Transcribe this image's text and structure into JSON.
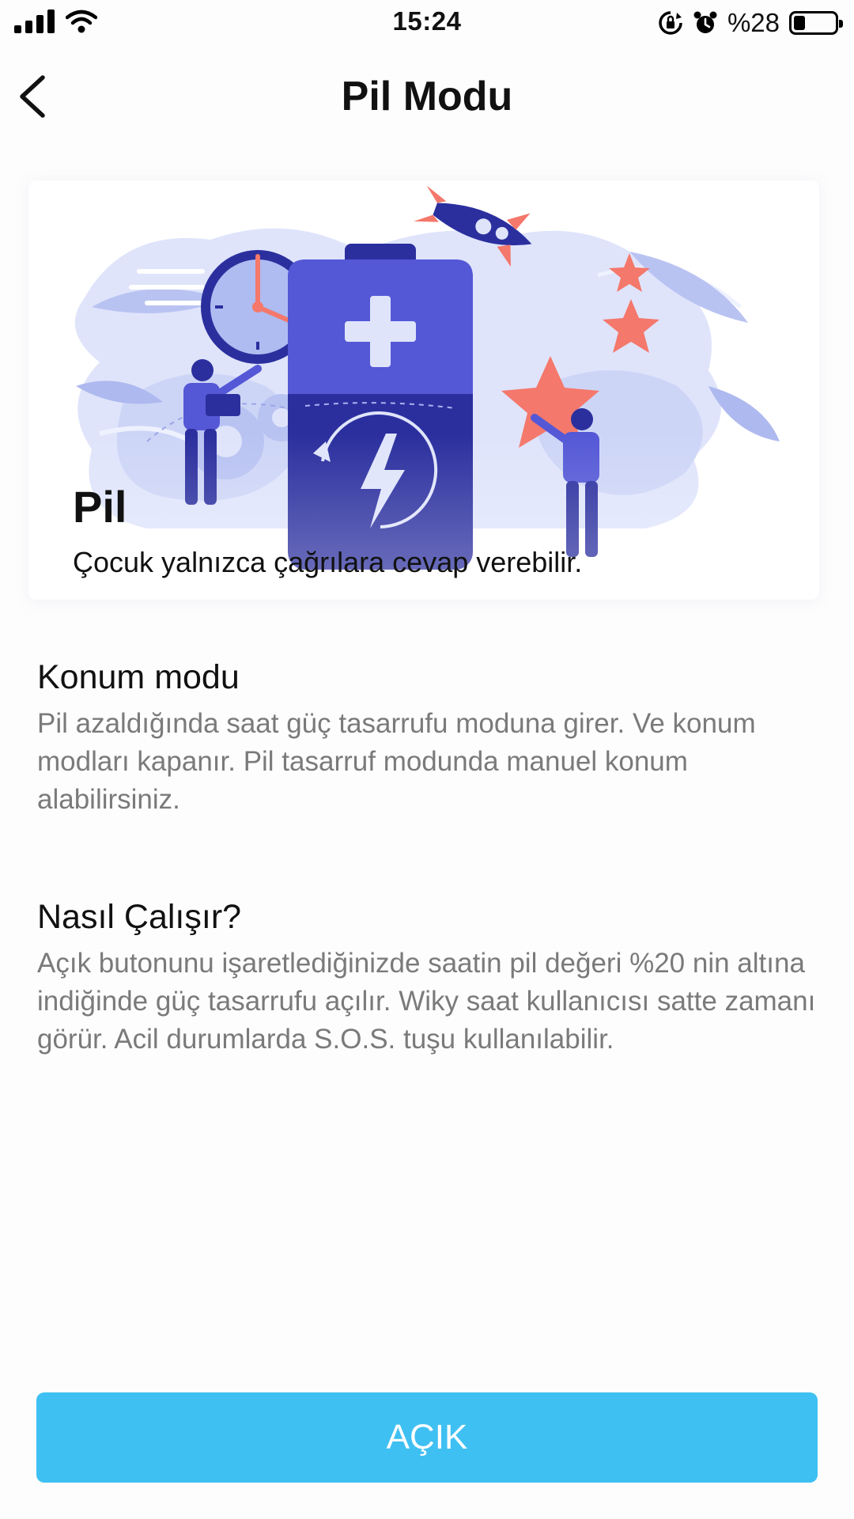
{
  "status_bar": {
    "time": "15:24",
    "battery_text": "%28",
    "battery_level": 0.28,
    "icons": [
      "signal-icon",
      "wifi-icon",
      "rotation-lock-icon",
      "alarm-icon",
      "battery-icon"
    ]
  },
  "header": {
    "title": "Pil Modu",
    "back_icon": "chevron-left-icon"
  },
  "hero": {
    "title": "Pil",
    "subtitle": "Çocuk yalnızca çağrılara cevap verebilir."
  },
  "sections": [
    {
      "title": "Konum modu",
      "body": "Pil azaldığında saat güç tasarrufu moduna girer. Ve konum modları kapanır. Pil tasarruf modunda manuel konum alabilirsiniz."
    },
    {
      "title": "Nasıl Çalışır?",
      "body": "Açık butonunu işaretlediğinizde saatin pil değeri %20 nin altına indiğinde güç tasarrufu açılır. Wiky saat kullanıcısı satte zamanı görür. Acil durumlarda S.O.S. tuşu kullanılabilir."
    }
  ],
  "button": {
    "label": "AÇIK"
  },
  "colors": {
    "accent": "#3fc0f2",
    "battery_dark": "#2b2f9e",
    "battery_light": "#5458d6",
    "star": "#f4786b",
    "illustration_bg": "#dfe4fb"
  }
}
